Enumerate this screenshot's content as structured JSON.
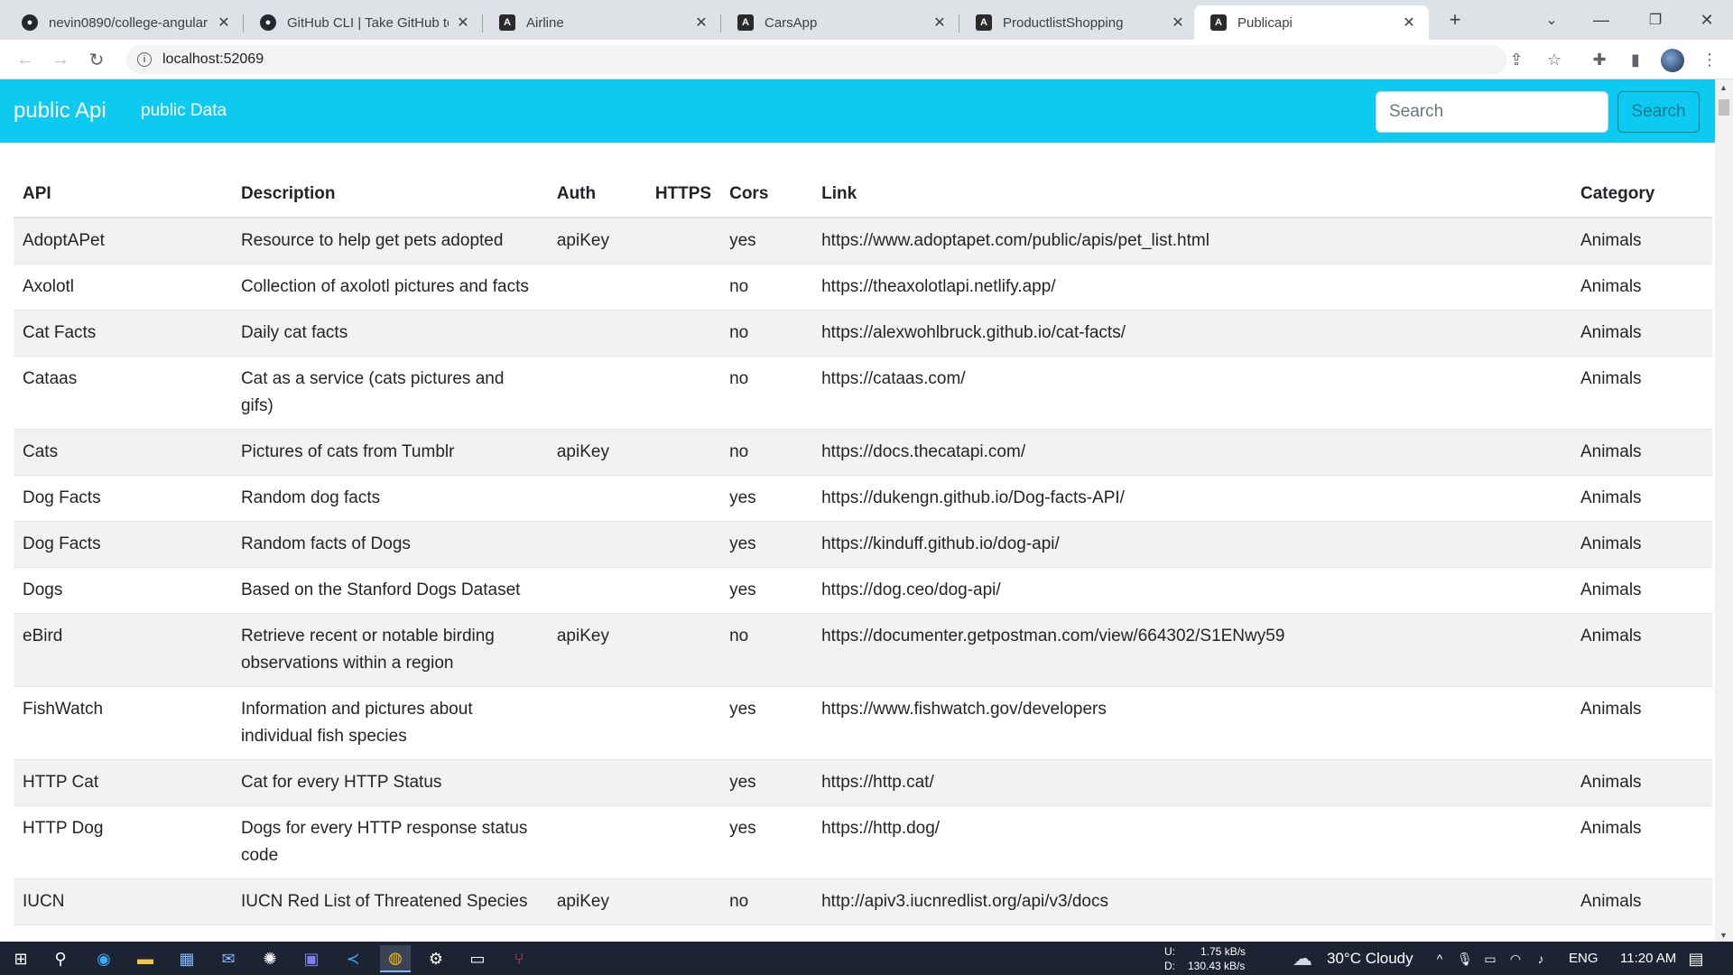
{
  "browser": {
    "tabs": [
      {
        "title": "nevin0890/college-angular",
        "icon": "github-icon"
      },
      {
        "title": "GitHub CLI | Take GitHub to",
        "icon": "github-icon"
      },
      {
        "title": "Airline",
        "icon": "angular-icon"
      },
      {
        "title": "CarsApp",
        "icon": "angular-icon"
      },
      {
        "title": "ProductlistShopping",
        "icon": "angular-icon"
      },
      {
        "title": "Publicapi",
        "icon": "angular-icon"
      }
    ],
    "active_tab": 5,
    "url": "localhost:52069"
  },
  "app": {
    "brand": "public Api",
    "nav_link": "public Data",
    "search": {
      "placeholder": "Search",
      "value": ""
    },
    "search_button": "Search",
    "accent_color": "#0dcaf0"
  },
  "table": {
    "headers": {
      "api": "API",
      "description": "Description",
      "auth": "Auth",
      "https": "HTTPS",
      "cors": "Cors",
      "link": "Link",
      "category": "Category"
    },
    "rows": [
      {
        "api": "AdoptAPet",
        "description": "Resource to help get pets adopted",
        "auth": "apiKey",
        "https": "",
        "cors": "yes",
        "link": "https://www.adoptapet.com/public/apis/pet_list.html",
        "category": "Animals"
      },
      {
        "api": "Axolotl",
        "description": "Collection of axolotl pictures and facts",
        "auth": "",
        "https": "",
        "cors": "no",
        "link": "https://theaxolotlapi.netlify.app/",
        "category": "Animals"
      },
      {
        "api": "Cat Facts",
        "description": "Daily cat facts",
        "auth": "",
        "https": "",
        "cors": "no",
        "link": "https://alexwohlbruck.github.io/cat-facts/",
        "category": "Animals"
      },
      {
        "api": "Cataas",
        "description": "Cat as a service (cats pictures and gifs)",
        "auth": "",
        "https": "",
        "cors": "no",
        "link": "https://cataas.com/",
        "category": "Animals"
      },
      {
        "api": "Cats",
        "description": "Pictures of cats from Tumblr",
        "auth": "apiKey",
        "https": "",
        "cors": "no",
        "link": "https://docs.thecatapi.com/",
        "category": "Animals"
      },
      {
        "api": "Dog Facts",
        "description": "Random dog facts",
        "auth": "",
        "https": "",
        "cors": "yes",
        "link": "https://dukengn.github.io/Dog-facts-API/",
        "category": "Animals"
      },
      {
        "api": "Dog Facts",
        "description": "Random facts of Dogs",
        "auth": "",
        "https": "",
        "cors": "yes",
        "link": "https://kinduff.github.io/dog-api/",
        "category": "Animals"
      },
      {
        "api": "Dogs",
        "description": "Based on the Stanford Dogs Dataset",
        "auth": "",
        "https": "",
        "cors": "yes",
        "link": "https://dog.ceo/dog-api/",
        "category": "Animals"
      },
      {
        "api": "eBird",
        "description": "Retrieve recent or notable birding observations within a region",
        "auth": "apiKey",
        "https": "",
        "cors": "no",
        "link": "https://documenter.getpostman.com/view/664302/S1ENwy59",
        "category": "Animals"
      },
      {
        "api": "FishWatch",
        "description": "Information and pictures about individual fish species",
        "auth": "",
        "https": "",
        "cors": "yes",
        "link": "https://www.fishwatch.gov/developers",
        "category": "Animals"
      },
      {
        "api": "HTTP Cat",
        "description": "Cat for every HTTP Status",
        "auth": "",
        "https": "",
        "cors": "yes",
        "link": "https://http.cat/",
        "category": "Animals"
      },
      {
        "api": "HTTP Dog",
        "description": "Dogs for every HTTP response status code",
        "auth": "",
        "https": "",
        "cors": "yes",
        "link": "https://http.dog/",
        "category": "Animals"
      },
      {
        "api": "IUCN",
        "description": "IUCN Red List of Threatened Species",
        "auth": "apiKey",
        "https": "",
        "cors": "no",
        "link": "http://apiv3.iucnredlist.org/api/v3/docs",
        "category": "Animals"
      }
    ]
  },
  "taskbar": {
    "net_up": "U:",
    "net_up_value": "1.75 kB/s",
    "net_down": "D:",
    "net_down_value": "130.43 kB/s",
    "weather": "30°C  Cloudy",
    "language": "ENG",
    "time": "11:20 AM"
  }
}
